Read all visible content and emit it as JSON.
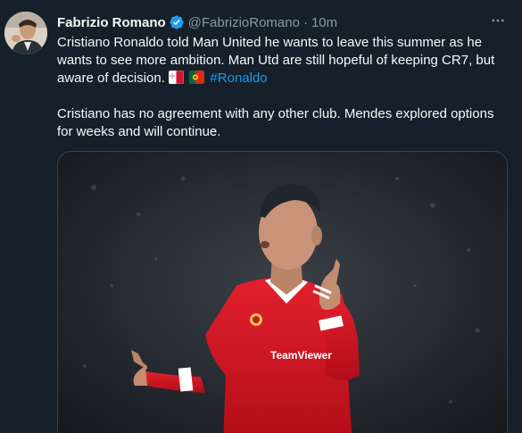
{
  "author": {
    "name": "Fabrizio Romano",
    "handle": "@FabrizioRomano",
    "separator": "·",
    "time": "10m",
    "verified": true
  },
  "tweet": {
    "paragraph1": "Cristiano Ronaldo told Man United he wants to leave this summer as he wants to see more ambition. Man Utd are still hopeful of keeping CR7, but aware of decision.",
    "flags": [
      "flag-malta-icon",
      "flag-portugal-icon"
    ],
    "hashtag": "#Ronaldo",
    "paragraph2": "Cristiano has no agreement with any other club. Mendes explored options for weeks and will continue."
  },
  "media": {
    "shirt_sponsor": "TeamViewer"
  },
  "colors": {
    "background": "#15202b",
    "text": "#f7f9f9",
    "secondary": "#8b98a5",
    "link": "#1d9bf0",
    "verified": "#1d9bf0",
    "shirt": "#d4121f"
  }
}
